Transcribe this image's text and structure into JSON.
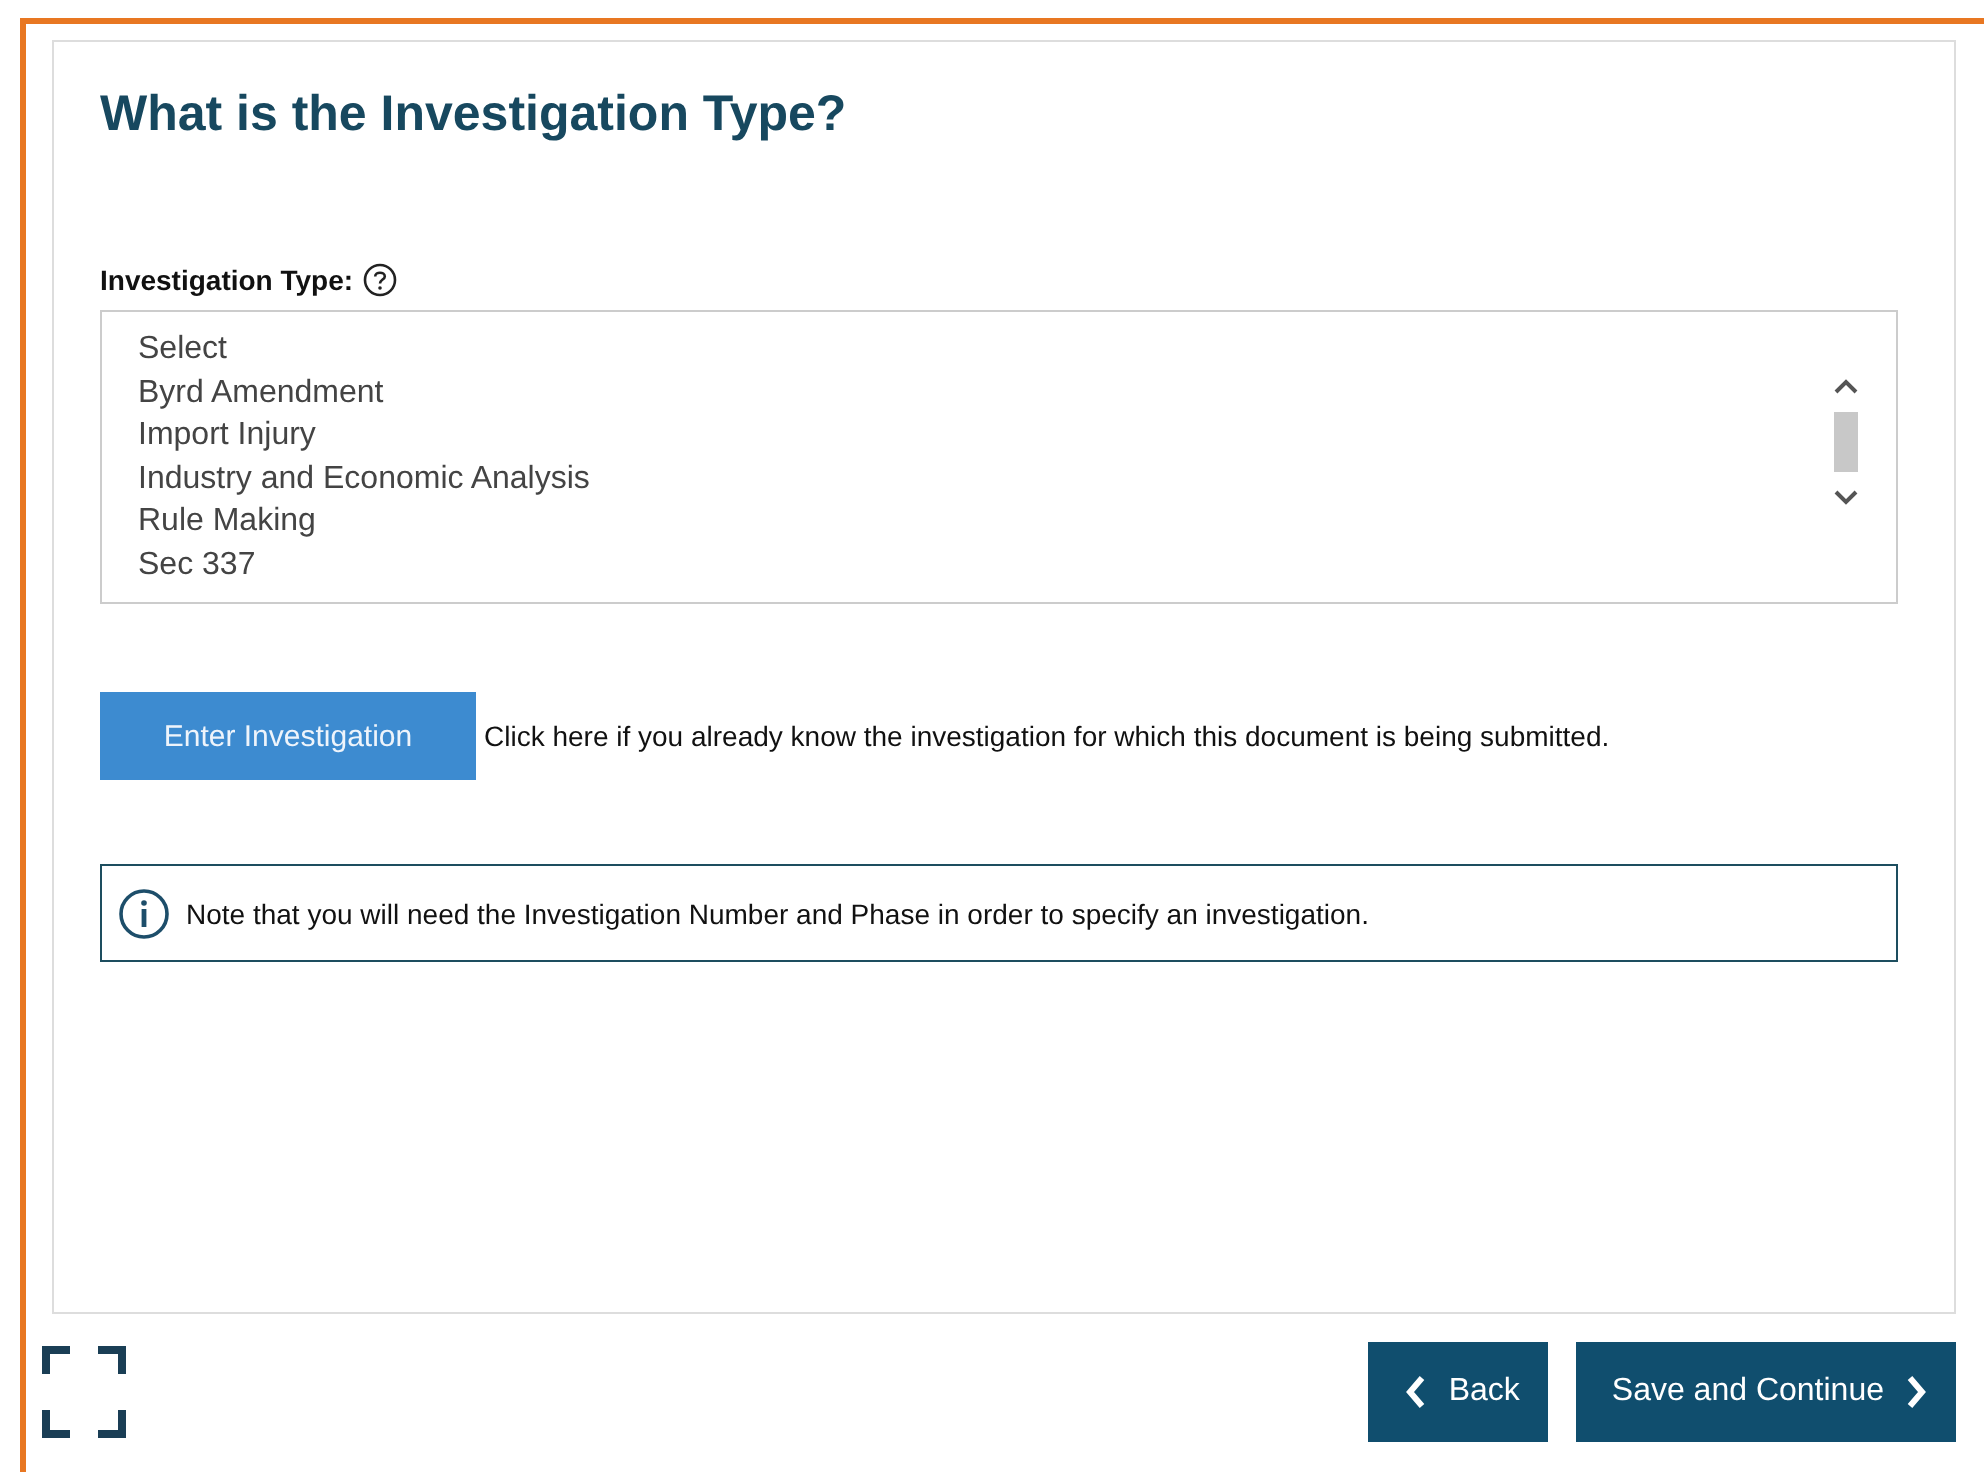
{
  "title": "What is the Investigation Type?",
  "field": {
    "label": "Investigation Type:",
    "options": [
      "Select",
      "Byrd Amendment",
      "Import Injury",
      "Industry and Economic Analysis",
      "Rule Making",
      "Sec 337"
    ]
  },
  "enter_button": "Enter Investigation",
  "enter_hint": "Click here if you already know the investigation for which this document is being submitted.",
  "note": "Note that you will need the Investigation Number and Phase in order to specify an investigation.",
  "buttons": [
    {
      "kind": "back",
      "label": "Back"
    },
    {
      "kind": "next",
      "label": "Save and Continue"
    }
  ]
}
